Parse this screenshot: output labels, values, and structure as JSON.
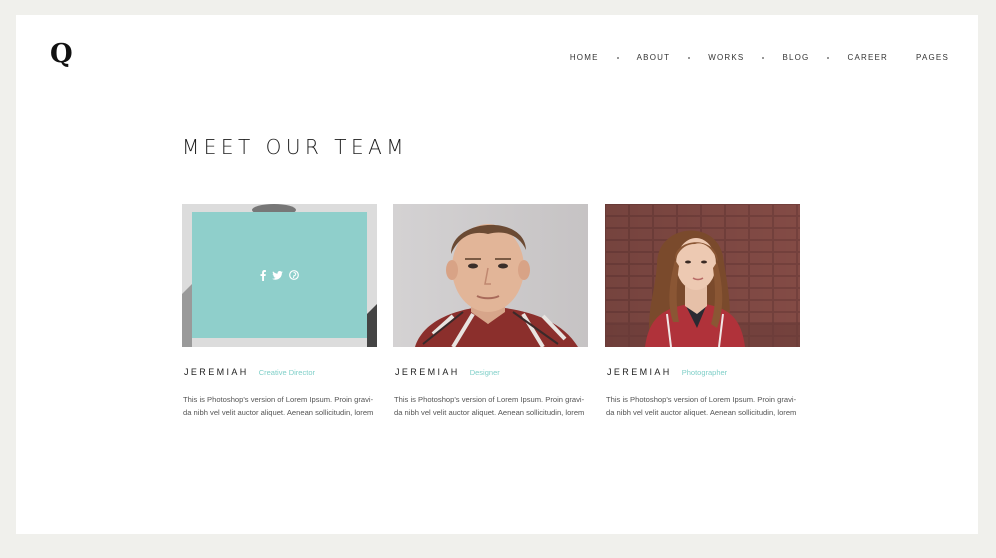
{
  "logo": "Q",
  "nav": {
    "items": [
      "HOME",
      "ABOUT",
      "WORKS",
      "BLOG",
      "CAREER",
      "PAGES"
    ]
  },
  "section_title": "MEET OUR TEAM",
  "team": [
    {
      "name": "JEREMIAH",
      "role": "Creative Director",
      "desc_line1": "This is Photoshop's version  of Lorem Ipsum. Proin gravi-",
      "desc_line2": "da nibh vel velit auctor aliquet. Aenean sollicitudin, lorem"
    },
    {
      "name": "JEREMIAH",
      "role": "Designer",
      "desc_line1": "This is Photoshop's version  of Lorem Ipsum. Proin gravi-",
      "desc_line2": "da nibh vel velit auctor aliquet. Aenean sollicitudin, lorem"
    },
    {
      "name": "JEREMIAH",
      "role": "Photographer",
      "desc_line1": "This is Photoshop's version  of Lorem Ipsum. Proin gravi-",
      "desc_line2": "da nibh vel velit auctor aliquet. Aenean sollicitudin, lorem"
    }
  ],
  "overlay_icons": [
    "facebook-icon",
    "twitter-icon",
    "pinterest-icon"
  ],
  "colors": {
    "accent": "#8fcfcb",
    "role_text": "#7fcfc8",
    "background": "#f0f0ec"
  }
}
